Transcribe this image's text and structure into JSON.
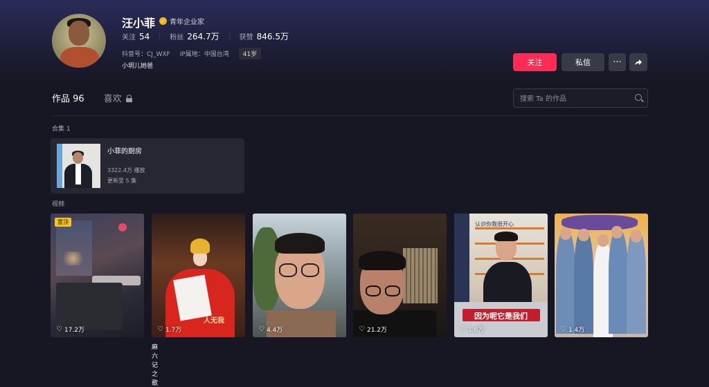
{
  "profile": {
    "name": "汪小菲",
    "badge": "青年企业家",
    "stats": [
      {
        "label": "关注",
        "value": "54"
      },
      {
        "label": "粉丝",
        "value": "264.7万"
      },
      {
        "label": "获赞",
        "value": "846.5万"
      }
    ],
    "douyin_id": "抖音号：CJ_WXF",
    "ip": "IP属地：中国台湾",
    "age": "41岁",
    "bio": "小玥儿她爸"
  },
  "actions": {
    "follow": "关注",
    "message": "私信",
    "more": "···"
  },
  "tabs": {
    "works": "作品 96",
    "likes": "喜欢"
  },
  "search": {
    "placeholder": "搜索 Ta 的作品"
  },
  "collections": {
    "label": "合集 1",
    "items": [
      {
        "title": "小菲的厨房",
        "plays": "3322.4万 播放",
        "updated": "更新至 5 集"
      }
    ]
  },
  "videos": {
    "label": "视频",
    "items": [
      {
        "likes": "17.2万",
        "pinned": "置顶",
        "caption": ""
      },
      {
        "likes": "1.7万",
        "caption": "麻六记之歌",
        "overlay": "人无我"
      },
      {
        "likes": "4.4万",
        "caption": ""
      },
      {
        "likes": "21.2万",
        "caption": ""
      },
      {
        "likes": "1.6万",
        "caption": "",
        "overlay": "因为呢它是我们",
        "top_text": "认识你我很开心"
      },
      {
        "likes": "1.4万",
        "caption": ""
      }
    ]
  }
}
